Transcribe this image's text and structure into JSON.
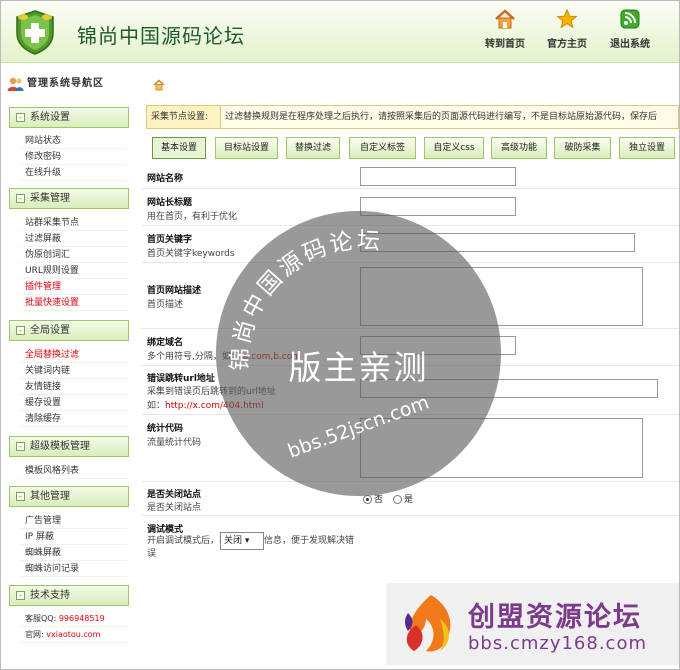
{
  "header": {
    "title": "锦尚中国源码论坛",
    "nav": [
      {
        "label": "转到首页",
        "icon": "home-icon"
      },
      {
        "label": "官方主页",
        "icon": "star-icon"
      },
      {
        "label": "退出系统",
        "icon": "logout-icon"
      }
    ]
  },
  "sidebar": {
    "heading": "管理系统导航区",
    "groups": [
      {
        "title": "系统设置",
        "items": [
          {
            "label": "网站状态"
          },
          {
            "label": "修改密码"
          },
          {
            "label": "在线升级"
          }
        ]
      },
      {
        "title": "采集管理",
        "items": [
          {
            "label": "站群采集节点"
          },
          {
            "label": "过滤屏蔽"
          },
          {
            "label": "伪原创词汇"
          },
          {
            "label": "URL规则设置"
          },
          {
            "label": "插件管理",
            "highlight": true
          },
          {
            "label": "批量快速设置",
            "highlight": true
          }
        ]
      },
      {
        "title": "全局设置",
        "items": [
          {
            "label": "全局替换过滤",
            "highlight": true
          },
          {
            "label": "关键词内链"
          },
          {
            "label": "友情链接"
          },
          {
            "label": "缓存设置"
          },
          {
            "label": "清除缓存"
          }
        ]
      },
      {
        "title": "超级模板管理",
        "items": [
          {
            "label": "模板风格列表"
          }
        ]
      },
      {
        "title": "其他管理",
        "items": [
          {
            "label": "广告管理"
          },
          {
            "label": "IP 屏蔽"
          },
          {
            "label": "蜘蛛屏蔽"
          },
          {
            "label": "蜘蛛访问记录"
          }
        ]
      },
      {
        "title": "技术支持",
        "items": []
      }
    ],
    "support": {
      "qq_label": "客服QQ:",
      "qq_value": "996948519",
      "site_label": "官网:",
      "site_value": "vxiaotou.com"
    }
  },
  "config_bar": {
    "label": "采集节点设置:",
    "text": "过滤替换规则是在程序处理之后执行，请按照采集后的页面源代码进行编写，不是目标站原始源代码，保存后"
  },
  "tabs": [
    "基本设置",
    "目标站设置",
    "替换过滤",
    "自定义标签",
    "自定义css",
    "高级功能",
    "破防采集",
    "独立设置"
  ],
  "active_tab": 0,
  "form": {
    "site_name": {
      "label": "网站名称",
      "value": ""
    },
    "site_long_title": {
      "label": "网站长标题",
      "desc": "用在首页，有利于优化",
      "value": ""
    },
    "home_keywords": {
      "label": "首页关键字",
      "desc": "首页关键字keywords",
      "value": ""
    },
    "home_description": {
      "label": "首页网站描述",
      "desc": "首页描述",
      "value": ""
    },
    "bind_domain": {
      "label": "绑定域名",
      "desc": "多个用符号,分隔，如：",
      "example": "a.com,b.com",
      "value": ""
    },
    "error_redirect": {
      "label": "错误跳转url地址",
      "desc": "采集到错误页后跳转到的url地址",
      "example_prefix": "如：",
      "example": "http://x.com/404.html",
      "value": ""
    },
    "stats_code": {
      "label": "统计代码",
      "desc": "流量统计代码",
      "value": ""
    },
    "close_site": {
      "label": "是否关闭站点",
      "desc": "是否关闭站点",
      "options": [
        "否",
        "是"
      ],
      "selected": "否"
    },
    "debug_mode": {
      "label": "调试模式",
      "desc": "开启调试模式后，将输出调试信息，便于发现解决错误",
      "value": "关闭"
    }
  },
  "watermark": {
    "arc_text": "锦尚中国源码论坛",
    "main": "版主亲测",
    "url": "bbs.52jscn.com"
  },
  "promo": {
    "title": "创盟资源论坛",
    "url": "bbs.cmzy168.com"
  },
  "colors": {
    "header_bg": "#e4f2cb",
    "sidebar_border": "#9fc46a",
    "title_green": "#1d5b2a",
    "highlight_red": "#e0000b",
    "watermark_gray": "#5a5a5a",
    "promo_purple": "#7c3a8b"
  }
}
